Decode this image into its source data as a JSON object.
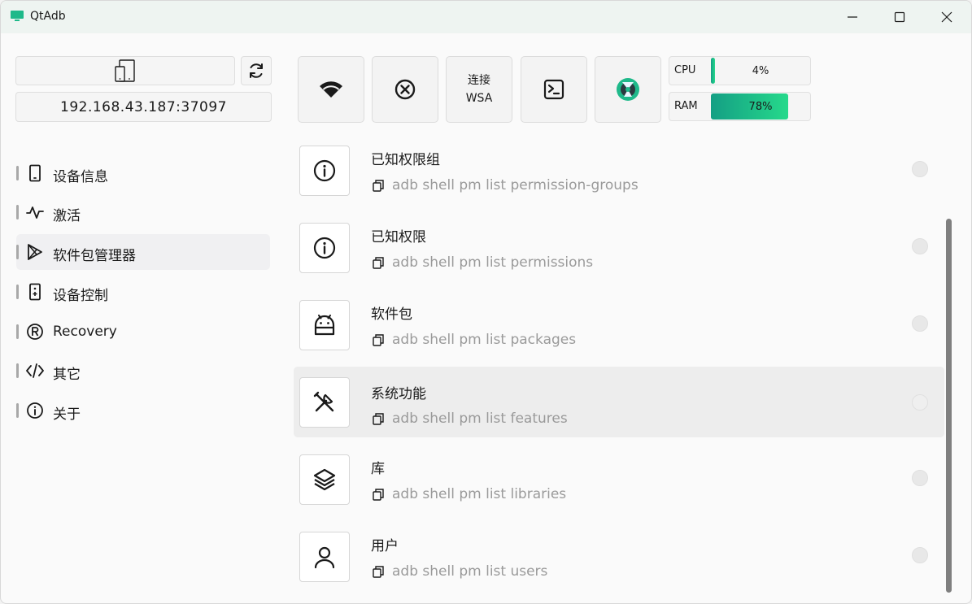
{
  "window": {
    "title": "QtAdb",
    "colors": {
      "accent": "#1fb98a",
      "title_bar": "#eef4f1"
    }
  },
  "device": {
    "address": "192.168.43.187:37097"
  },
  "toolbar": {
    "wsa_label_line1": "连接",
    "wsa_label_line2": "WSA"
  },
  "meters": {
    "cpu": {
      "label": "CPU",
      "value": "4%",
      "fraction": 0.04
    },
    "ram": {
      "label": "RAM",
      "value": "78%",
      "fraction": 0.78
    }
  },
  "sidebar": {
    "items": [
      {
        "label": "设备信息",
        "icon": "phone-icon"
      },
      {
        "label": "激活",
        "icon": "pulse-icon"
      },
      {
        "label": "软件包管理器",
        "icon": "play-store-icon",
        "active": true
      },
      {
        "label": "设备控制",
        "icon": "remote-icon"
      },
      {
        "label": "Recovery",
        "icon": "registered-icon"
      },
      {
        "label": "其它",
        "icon": "code-icon"
      },
      {
        "label": "关于",
        "icon": "info-icon"
      }
    ]
  },
  "list": {
    "items": [
      {
        "title": "已知权限组",
        "command": "adb shell pm list permission-groups",
        "icon": "info-icon"
      },
      {
        "title": "已知权限",
        "command": "adb shell pm list permissions",
        "icon": "info-icon"
      },
      {
        "title": "软件包",
        "command": "adb shell pm list packages",
        "icon": "android-icon"
      },
      {
        "title": "系统功能",
        "command": "adb shell pm list features",
        "icon": "tools-icon"
      },
      {
        "title": "库",
        "command": "adb shell pm list libraries",
        "icon": "layers-icon"
      },
      {
        "title": "用户",
        "command": "adb shell pm list users",
        "icon": "user-icon"
      }
    ]
  }
}
